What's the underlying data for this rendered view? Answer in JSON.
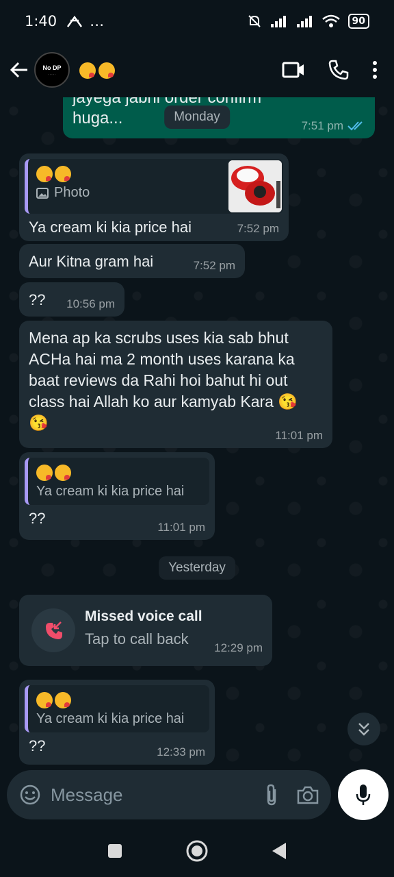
{
  "status_bar": {
    "time": "1:40",
    "extra": "…",
    "battery": "90"
  },
  "header": {
    "avatar_text": "No DP",
    "contact_emoji": "😘😘"
  },
  "chat": {
    "top_message_text": "jayega jabhi order confirm huga...",
    "top_message_time": "7:51 pm",
    "date_monday": "Monday",
    "msg1": {
      "quote_emoji": "😘😘",
      "quote_label": "Photo",
      "text": "Ya cream ki kia price hai",
      "time": "7:52 pm"
    },
    "msg2": {
      "text": "Aur Kitna gram hai",
      "time": "7:52 pm"
    },
    "msg3": {
      "text": "??",
      "time": "10:56 pm"
    },
    "msg4": {
      "text": "Mena ap ka scrubs uses kia sab bhut ACHa hai ma 2 month uses  karana ka baat reviews da Rahi hoi  bahut hi out class  hai Allah ko aur kamyab Kara 😘😘",
      "time": "11:01 pm"
    },
    "msg5": {
      "quote_emoji": "😘😘",
      "quote_text": "Ya cream ki kia price hai",
      "text": "??",
      "time": "11:01 pm"
    },
    "date_yesterday": "Yesterday",
    "call": {
      "title": "Missed voice call",
      "subtitle": "Tap to call back",
      "time": "12:29 pm"
    },
    "msg6": {
      "quote_emoji": "😘😘",
      "quote_text": "Ya cream ki kia price hai",
      "text": "??",
      "time": "12:33 pm"
    }
  },
  "composer": {
    "placeholder": "Message"
  },
  "icons": {
    "back": "back-arrow-icon",
    "video": "video-call-icon",
    "phone": "voice-call-icon",
    "menu": "more-vertical-icon",
    "emoji": "emoji-icon",
    "attach": "paperclip-icon",
    "camera": "camera-icon",
    "mic": "microphone-icon"
  }
}
